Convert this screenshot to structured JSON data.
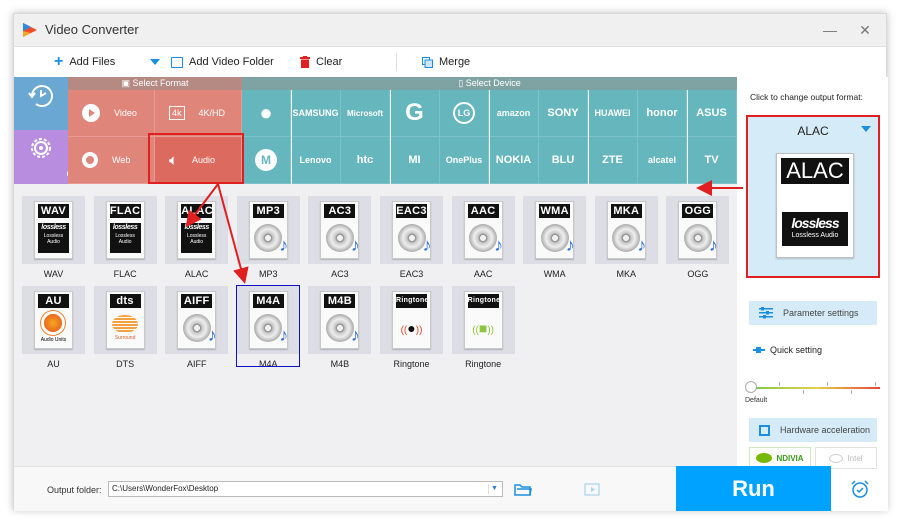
{
  "window": {
    "title": "Video Converter",
    "minimize_icon": "minimize-icon",
    "close_icon": "close-icon"
  },
  "toolbar": {
    "add_files": "Add Files",
    "add_video_folder": "Add Video Folder",
    "clear": "Clear",
    "merge": "Merge"
  },
  "side_tabs": [
    {
      "label": "History",
      "icon": "clock-icon",
      "color": "#6aa7d2"
    },
    {
      "label": "Custom",
      "icon": "gear-icon",
      "color": "#b88de0"
    }
  ],
  "select_format": {
    "header": "Select Format",
    "tabs": [
      {
        "label": "Video",
        "icon": "play-icon"
      },
      {
        "label": "4K/HD",
        "icon": "4k-icon"
      },
      {
        "label": "Web",
        "icon": "chrome-icon"
      },
      {
        "label": "Audio",
        "icon": "speaker-icon",
        "selected": true
      }
    ]
  },
  "select_device": {
    "header": "Select Device",
    "row1": [
      "Apple",
      "SAMSUNG",
      "Microsoft",
      "Google",
      "LG",
      "amazon",
      "SONY",
      "HUAWEI",
      "honor",
      "ASUS"
    ],
    "row2": [
      "Motorola",
      "Lenovo",
      "htc",
      "MI",
      "OnePlus",
      "NOKIA",
      "BLU",
      "ZTE",
      "alcatel",
      "TV"
    ]
  },
  "formats": [
    {
      "name": "WAV",
      "header": "WAV",
      "type": "lossless"
    },
    {
      "name": "FLAC",
      "header": "FLAC",
      "type": "lossless"
    },
    {
      "name": "ALAC",
      "header": "ALAC",
      "type": "lossless"
    },
    {
      "name": "MP3",
      "header": "MP3",
      "type": "disc"
    },
    {
      "name": "AC3",
      "header": "AC3",
      "type": "disc"
    },
    {
      "name": "EAC3",
      "header": "EAC3",
      "type": "disc"
    },
    {
      "name": "AAC",
      "header": "AAC",
      "type": "disc"
    },
    {
      "name": "WMA",
      "header": "WMA",
      "type": "disc"
    },
    {
      "name": "MKA",
      "header": "MKA",
      "type": "disc"
    },
    {
      "name": "OGG",
      "header": "OGG",
      "type": "disc"
    },
    {
      "name": "AU",
      "header": "AU",
      "type": "au",
      "sub": "Audio Units"
    },
    {
      "name": "DTS",
      "header": "dts",
      "type": "dts",
      "sub": "Surround"
    },
    {
      "name": "AIFF",
      "header": "AIFF",
      "type": "disc"
    },
    {
      "name": "M4A",
      "header": "M4A",
      "type": "disc",
      "selected": true
    },
    {
      "name": "M4B",
      "header": "M4B",
      "type": "disc"
    },
    {
      "name": "Ringtone",
      "header": "Ringtone",
      "type": "ring-apple"
    },
    {
      "name": "Ringtone",
      "header": "Ringtone",
      "type": "ring-android"
    }
  ],
  "lossless_text": {
    "logo": "lossless",
    "caption": "Lossless Audio"
  },
  "right_panel": {
    "hint": "Click to change output format:",
    "output_format": "ALAC",
    "output_caption": "Lossless Audio",
    "parameter_settings": "Parameter settings",
    "quick_setting": "Quick setting",
    "slider_label": "Default",
    "slider_value": 0,
    "hardware_acceleration": "Hardware acceleration",
    "nvidia": "NDIVIA",
    "intel": "Intel"
  },
  "bottom": {
    "output_folder_label": "Output folder:",
    "output_folder_value": "C:\\Users\\WonderFox\\Desktop",
    "run": "Run"
  },
  "colors": {
    "format_tab": "#e0857a",
    "format_tab_selected": "#dc6a5e",
    "device_tab": "#66b6bd",
    "run_button": "#00a2ff",
    "highlight_red": "#e02020",
    "selected_blue": "#1010c8"
  }
}
